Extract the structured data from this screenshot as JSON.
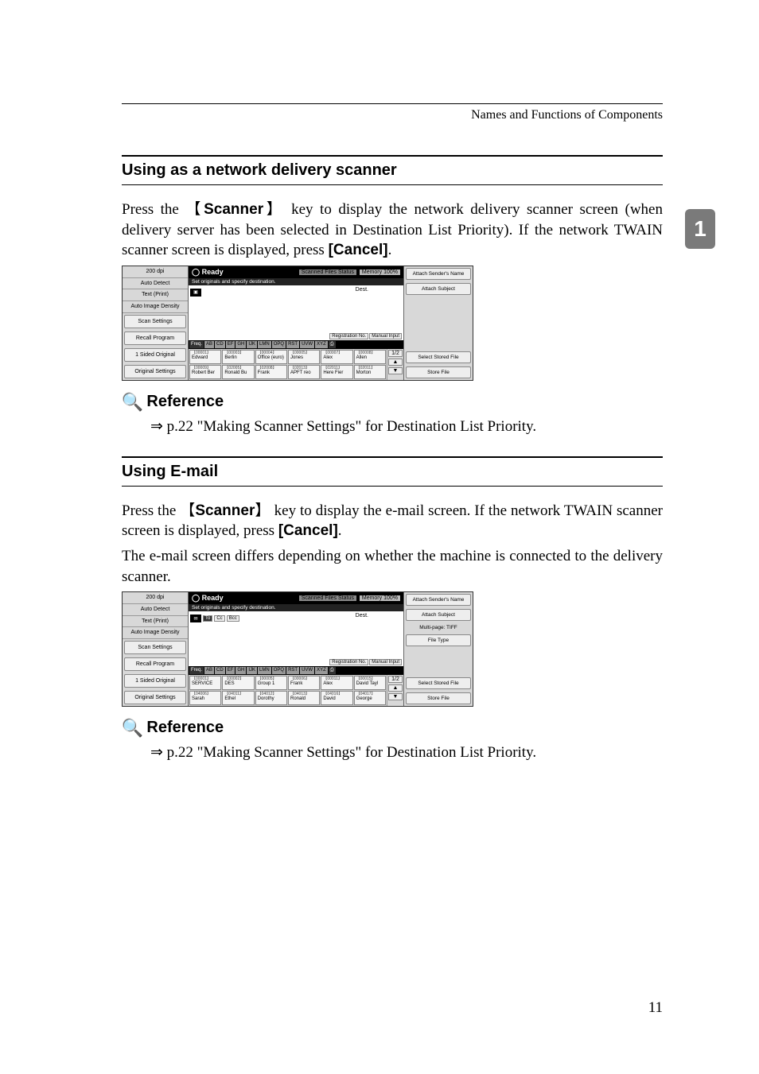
{
  "header": {
    "running_head": "Names and Functions of Components"
  },
  "tab": {
    "number": "1"
  },
  "sections": {
    "delivery": {
      "title": "Using as a network delivery scanner",
      "para_a": "Press the ",
      "key1": "Scanner",
      "para_b": " key to display the network delivery scanner screen (when delivery server has been selected in Destination List Priority). If the network TWAIN scanner screen is displayed, press ",
      "cancel": "[Cancel]",
      "period": "."
    },
    "email": {
      "title": "Using E-mail",
      "para_a": "Press the ",
      "key1": "Scanner",
      "para_b": " key to display the e-mail screen. If the network TWAIN scanner screen is displayed, press ",
      "cancel": "[Cancel]",
      "period": ".",
      "para2": "The e-mail screen differs depending on whether the machine is connected to the delivery scanner."
    }
  },
  "reference": {
    "heading": "Reference",
    "arrow": "⇒",
    "text": " p.22 \"Making Scanner Settings\" for Destination List Priority."
  },
  "panel_delivery": {
    "left": {
      "res": "200 dpi",
      "detect": "Auto Detect",
      "text": "Text (Print)",
      "density": "Auto Image Density",
      "btn_scan": "Scan Settings",
      "btn_recall": "Recall Program",
      "btn_sided": "1 Sided Original",
      "btn_orig": "Original Settings"
    },
    "readybar": {
      "ready": "◯ Ready",
      "status": "Scanned Files Status",
      "memory": "Memory 100%"
    },
    "subbar": "Set originals and specify destination.",
    "dest_label": "Dest.",
    "midbtns": {
      "reg": "Registration No.",
      "manual": "Manual Input"
    },
    "tabs": [
      "Freq.",
      "AB",
      "CD",
      "EF",
      "GH",
      "IJK",
      "LMN",
      "OPQ",
      "RST",
      "UVW",
      "XYZ",
      "⎙"
    ],
    "addr": [
      {
        "n": "【00001】",
        "t": "Edward"
      },
      {
        "n": "【00003】",
        "t": "Berlin"
      },
      {
        "n": "【00004】",
        "t": "Office (euro)"
      },
      {
        "n": "【00005】",
        "t": "Jones"
      },
      {
        "n": "【00007】",
        "t": "Alex"
      },
      {
        "n": "【00008】",
        "t": "Allen"
      },
      {
        "n": "【00009】",
        "t": "Robert Ber"
      },
      {
        "n": "【02005】",
        "t": "Ronald Bu"
      },
      {
        "n": "【02008】",
        "t": "Frank"
      },
      {
        "n": "【02013】",
        "t": "APFT reo"
      },
      {
        "n": "【02011】",
        "t": "Here Fier"
      },
      {
        "n": "【02011】",
        "t": "Morton"
      }
    ],
    "pager": {
      "count": "1/2",
      "up": "▲",
      "down": "▼"
    },
    "right": {
      "sender": "Attach Sender's Name",
      "subject": "Attach Subject",
      "select": "Select Stored File",
      "store": "Store File"
    }
  },
  "panel_email": {
    "left": {
      "res": "200 dpi",
      "detect": "Auto Detect",
      "text": "Text (Print)",
      "density": "Auto Image Density",
      "btn_scan": "Scan Settings",
      "btn_recall": "Recall Program",
      "btn_sided": "1 Sided Original",
      "btn_orig": "Original Settings"
    },
    "readybar": {
      "ready": "◯ Ready",
      "status": "Scanned Files Status",
      "memory": "Memory 100%"
    },
    "subbar": "Set originals and specify destination.",
    "dest_label": "Dest.",
    "to_cc_bcc": {
      "to": "To",
      "cc": "Cc",
      "bcc": "Bcc"
    },
    "midbtns": {
      "reg": "Registration No.",
      "manual": "Manual Input"
    },
    "tabs": [
      "Freq.",
      "AB",
      "CD",
      "EF",
      "GH",
      "IJK",
      "LMN",
      "OPQ",
      "RST",
      "UVW",
      "XYZ",
      "⎙"
    ],
    "addr": [
      {
        "n": "【00001】",
        "t": "SERVICE"
      },
      {
        "n": "【00002】",
        "t": "DES"
      },
      {
        "n": "【00005】",
        "t": "Group 1"
      },
      {
        "n": "【00006】",
        "t": "Frank"
      },
      {
        "n": "【00011】",
        "t": "Alex"
      },
      {
        "n": "【00015】",
        "t": "David Tayl"
      },
      {
        "n": "【04006】",
        "t": "Sarah"
      },
      {
        "n": "【04011】",
        "t": "Ethel"
      },
      {
        "n": "【04012】",
        "t": "Dorothy"
      },
      {
        "n": "【04013】",
        "t": "Ronald"
      },
      {
        "n": "【04016】",
        "t": "David"
      },
      {
        "n": "【04017】",
        "t": "George"
      }
    ],
    "pager": {
      "count": "1/2",
      "up": "▲",
      "down": "▼"
    },
    "right": {
      "sender": "Attach Sender's Name",
      "subject": "Attach Subject",
      "filetype_h": "Multi-page: TIFF",
      "filetype_b": "File Type",
      "select": "Select Stored File",
      "store": "Store File"
    }
  },
  "page_number": "11"
}
